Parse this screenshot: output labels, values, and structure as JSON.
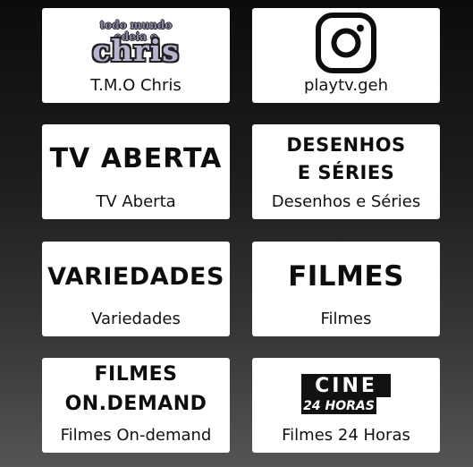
{
  "tiles": [
    {
      "label": "T.M.O Chris",
      "logo": {
        "line1": "todo mundo",
        "line2": "odeia o",
        "line3": "chris"
      }
    },
    {
      "label": "playtv.geh",
      "logo": {
        "icon": "instagram-icon"
      }
    },
    {
      "label": "TV Aberta",
      "logo": {
        "text": "TV ABERTA"
      }
    },
    {
      "label": "Desenhos e Séries",
      "logo": {
        "line1": "DESENHOS",
        "line2": "E SÉRIES"
      }
    },
    {
      "label": "Variedades",
      "logo": {
        "text": "VARIEDADES"
      }
    },
    {
      "label": "Filmes",
      "logo": {
        "text": "FILMES"
      }
    },
    {
      "label": "Filmes On-demand",
      "logo": {
        "line1": "FILMES",
        "line2": "ON.DEMAND"
      }
    },
    {
      "label": "Filmes 24 Horas",
      "logo": {
        "line1": "CINE",
        "line2": "24 HORAS"
      }
    }
  ]
}
